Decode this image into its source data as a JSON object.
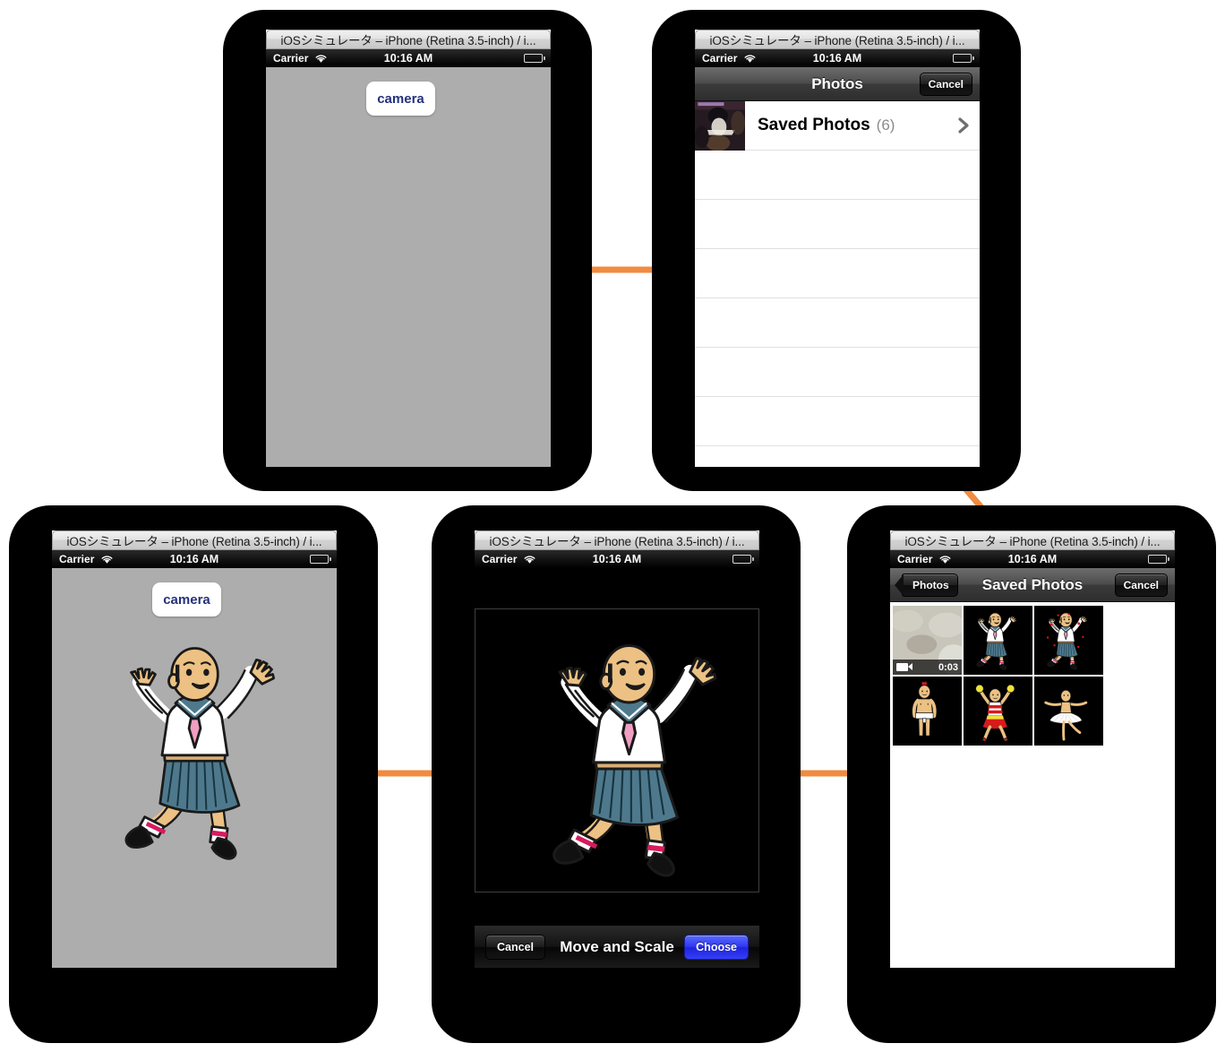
{
  "simulator": {
    "window_title": "iOSシミュレータ – iPhone (Retina 3.5-inch) / i...",
    "status": {
      "carrier": "Carrier",
      "time": "10:16 AM",
      "wifi_icon": "wifi-icon",
      "battery_icon": "battery-icon"
    }
  },
  "accent": {
    "arrow_color": "#F08B3F",
    "app_background": "#ADADAD",
    "choose_blue": "#2E37F0"
  },
  "screens": {
    "step1_camera": {
      "camera_button_label": "camera",
      "has_photo": false
    },
    "step2_album_list": {
      "nav_title": "Photos",
      "cancel_label": "Cancel",
      "rows": [
        {
          "label": "Saved Photos",
          "count": "(6)",
          "chevron": "chevron-right-icon",
          "has_thumb": true
        },
        {
          "label": "",
          "count": "",
          "chevron": "",
          "has_thumb": false
        },
        {
          "label": "",
          "count": "",
          "chevron": "",
          "has_thumb": false
        },
        {
          "label": "",
          "count": "",
          "chevron": "",
          "has_thumb": false
        },
        {
          "label": "",
          "count": "",
          "chevron": "",
          "has_thumb": false
        },
        {
          "label": "",
          "count": "",
          "chevron": "",
          "has_thumb": false
        },
        {
          "label": "",
          "count": "",
          "chevron": "",
          "has_thumb": false
        }
      ]
    },
    "step3_photo_grid": {
      "back_label": "Photos",
      "nav_title": "Saved Photos",
      "cancel_label": "Cancel",
      "cells": [
        {
          "kind": "video",
          "duration": "0:03",
          "video_icon": "video-camera-icon"
        },
        {
          "kind": "photo-sailor-jump",
          "duration": "",
          "video_icon": ""
        },
        {
          "kind": "photo-sailor-sparkle",
          "duration": "",
          "video_icon": ""
        },
        {
          "kind": "photo-underwear",
          "duration": "",
          "video_icon": ""
        },
        {
          "kind": "photo-cheerleader",
          "duration": "",
          "video_icon": ""
        },
        {
          "kind": "photo-ballerina",
          "duration": "",
          "video_icon": ""
        }
      ]
    },
    "step4_move_and_scale": {
      "cancel_label": "Cancel",
      "title": "Move and Scale",
      "choose_label": "Choose"
    },
    "step5_result": {
      "camera_button_label": "camera",
      "has_photo": true
    }
  },
  "arrows": [
    {
      "name": "arrow-camera-to-albums",
      "direction": "right"
    },
    {
      "name": "arrow-albums-to-grid",
      "direction": "down-right"
    },
    {
      "name": "arrow-grid-to-crop",
      "direction": "left"
    },
    {
      "name": "arrow-crop-to-result",
      "direction": "left"
    }
  ]
}
